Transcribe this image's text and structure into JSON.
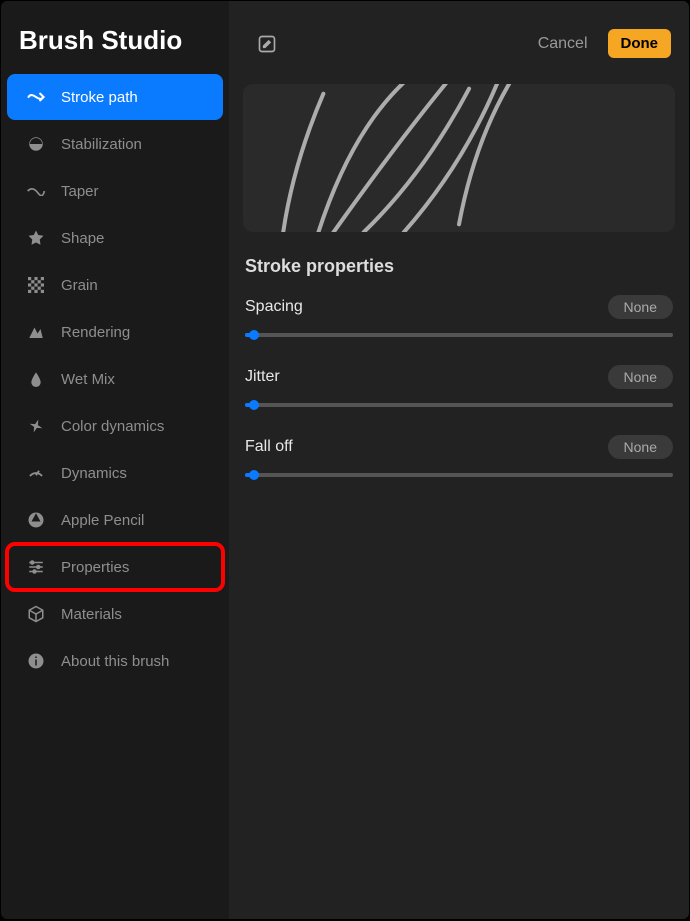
{
  "title": "Brush Studio",
  "sidebar": {
    "items": [
      {
        "label": "Stroke path",
        "icon": "stroke-path-icon"
      },
      {
        "label": "Stabilization",
        "icon": "stabilization-icon"
      },
      {
        "label": "Taper",
        "icon": "taper-icon"
      },
      {
        "label": "Shape",
        "icon": "shape-icon"
      },
      {
        "label": "Grain",
        "icon": "grain-icon"
      },
      {
        "label": "Rendering",
        "icon": "rendering-icon"
      },
      {
        "label": "Wet Mix",
        "icon": "wet-mix-icon"
      },
      {
        "label": "Color dynamics",
        "icon": "color-dynamics-icon"
      },
      {
        "label": "Dynamics",
        "icon": "dynamics-icon"
      },
      {
        "label": "Apple Pencil",
        "icon": "apple-pencil-icon"
      },
      {
        "label": "Properties",
        "icon": "properties-icon"
      },
      {
        "label": "Materials",
        "icon": "materials-icon"
      },
      {
        "label": "About this brush",
        "icon": "about-icon"
      }
    ]
  },
  "header": {
    "cancel": "Cancel",
    "done": "Done"
  },
  "section_title": "Stroke properties",
  "sliders": [
    {
      "label": "Spacing",
      "value": "None",
      "percent": 2
    },
    {
      "label": "Jitter",
      "value": "None",
      "percent": 2
    },
    {
      "label": "Fall off",
      "value": "None",
      "percent": 2
    }
  ]
}
